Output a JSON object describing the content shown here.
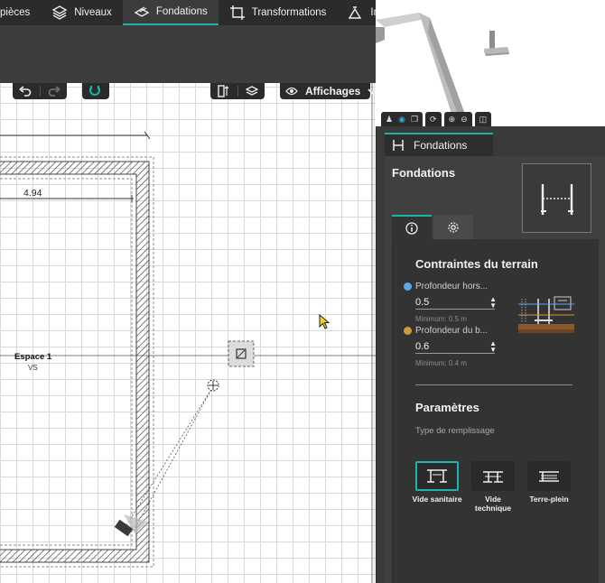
{
  "menu": {
    "tabs": [
      {
        "label": "pièces",
        "icon": "rooms-icon"
      },
      {
        "label": "Niveaux",
        "icon": "levels-icon"
      },
      {
        "label": "Fondations",
        "icon": "foundations-icon",
        "active": true
      },
      {
        "label": "Transformations",
        "icon": "transform-icon"
      },
      {
        "label": "Impla",
        "icon": "implantation-icon"
      }
    ]
  },
  "toolbar": {
    "display_label": "Affichages"
  },
  "plan": {
    "dimension": "4.94",
    "room_name": "Espace 1",
    "room_sub": "VS"
  },
  "panel": {
    "tab_label": "Fondations",
    "title": "Fondations",
    "constraints": {
      "title": "Contraintes du terrain",
      "frost": {
        "label": "Profondeur hors...",
        "value": "0.5",
        "hint": "Minimum: 0.5 m",
        "color": "#5aa9e6"
      },
      "bearing": {
        "label": "Profondeur du b...",
        "value": "0.6",
        "hint": "Minimum: 0.4 m",
        "color": "#d39a3a"
      }
    },
    "params": {
      "title": "Paramètres",
      "fill_type_label": "Type de remplissage",
      "options": [
        {
          "label": "Vide sanitaire",
          "selected": true
        },
        {
          "label": "Vide technique"
        },
        {
          "label": "Terre-plein"
        }
      ]
    }
  },
  "colors": {
    "accent": "#1fb3ad",
    "dark": "#2b2b2b"
  }
}
